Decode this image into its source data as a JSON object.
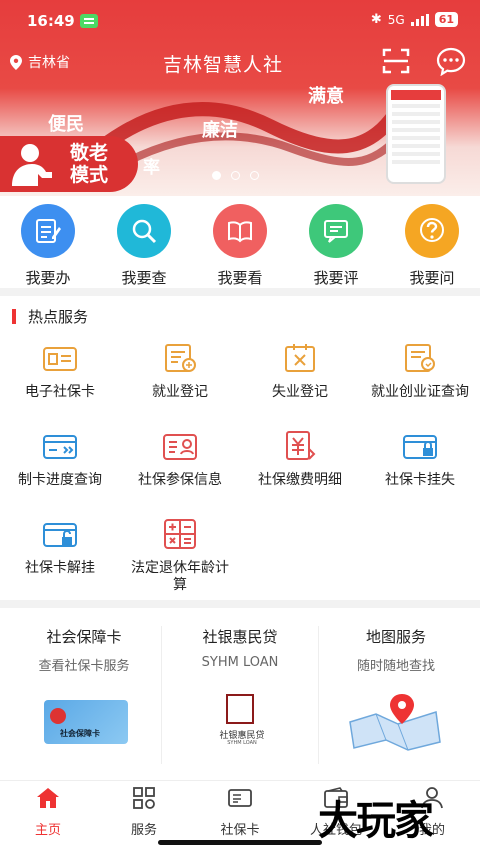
{
  "status_bar": {
    "time": "16:49",
    "network": "5G",
    "battery": "61"
  },
  "header": {
    "location": "吉林省",
    "title": "吉林智慧人社"
  },
  "banner": {
    "words": [
      "便民",
      "廉洁",
      "满意",
      "率"
    ],
    "elder_mode_label": "敬老模式"
  },
  "quick_actions": [
    {
      "label": "我要办",
      "icon": "edit-doc-icon",
      "color": "#3d8ff0"
    },
    {
      "label": "我要查",
      "icon": "search-icon",
      "color": "#20b8d8"
    },
    {
      "label": "我要看",
      "icon": "book-icon",
      "color": "#f06060"
    },
    {
      "label": "我要评",
      "icon": "comment-icon",
      "color": "#3ec87a"
    },
    {
      "label": "我要问",
      "icon": "question-icon",
      "color": "#f5a623"
    }
  ],
  "hot_services": {
    "title": "热点服务",
    "items": [
      {
        "label": "电子社保卡",
        "icon": "id-card-icon"
      },
      {
        "label": "就业登记",
        "icon": "employment-register-icon"
      },
      {
        "label": "失业登记",
        "icon": "unemployment-register-icon"
      },
      {
        "label": "就业创业证查询",
        "icon": "certificate-query-icon"
      },
      {
        "label": "制卡进度查询",
        "icon": "card-progress-icon"
      },
      {
        "label": "社保参保信息",
        "icon": "insurance-info-icon"
      },
      {
        "label": "社保缴费明细",
        "icon": "payment-detail-icon"
      },
      {
        "label": "社保卡挂失",
        "icon": "card-lock-icon"
      },
      {
        "label": "社保卡解挂",
        "icon": "card-unlock-icon"
      },
      {
        "label": "法定退休年龄计算",
        "icon": "calculator-icon"
      }
    ]
  },
  "cards": [
    {
      "title": "社会保障卡",
      "subtitle": "查看社保卡服务",
      "image_text": "社会保障卡"
    },
    {
      "title": "社银惠民贷",
      "subtitle": "SYHM LOAN",
      "image_text": "社银惠民贷",
      "image_sub": "SYHM LOAN"
    },
    {
      "title": "地图服务",
      "subtitle": "随时随地查找"
    }
  ],
  "tabs": [
    {
      "label": "主页",
      "icon": "home-icon",
      "active": true
    },
    {
      "label": "服务",
      "icon": "grid-icon",
      "active": false
    },
    {
      "label": "社保卡",
      "icon": "card-icon",
      "active": false
    },
    {
      "label": "人社钱包",
      "icon": "wallet-icon",
      "active": false
    },
    {
      "label": "我的",
      "icon": "person-icon",
      "active": false
    }
  ],
  "watermark": "大玩家",
  "colors": {
    "brand_red": "#e63d3d",
    "tab_active": "#e33333"
  }
}
